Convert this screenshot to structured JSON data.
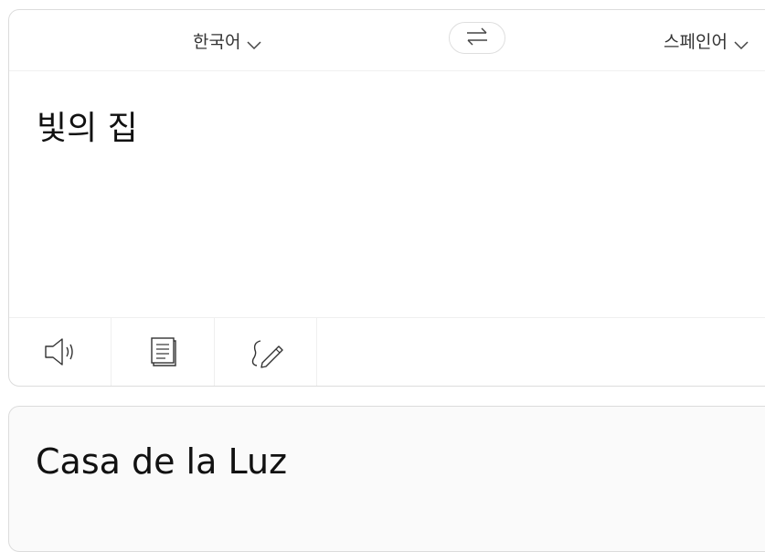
{
  "source_panel": {
    "source_language": "한국어",
    "target_language": "스페인어",
    "input_text": "빛의 집",
    "icons": {
      "chevron": "chevron-down-icon",
      "swap": "swap-arrows-icon",
      "speaker": "speaker-icon",
      "copy": "copy-icon",
      "handwrite": "handwriting-pen-icon"
    }
  },
  "result_panel": {
    "translated_text": "Casa de la Luz"
  }
}
